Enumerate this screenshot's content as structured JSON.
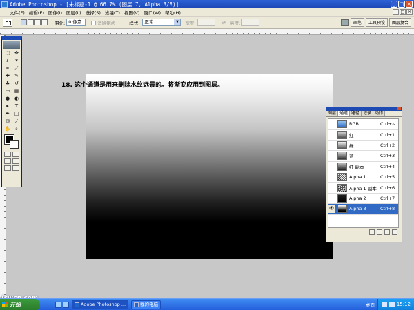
{
  "window": {
    "title": "Adobe Photoshop - [未标题-1 @ 66.7% (图层 7, Alpha 3/8)]"
  },
  "menu": [
    "文件(F)",
    "编辑(E)",
    "图像(I)",
    "图层(L)",
    "选择(S)",
    "滤镜(T)",
    "视图(V)",
    "窗口(W)",
    "帮助(H)"
  ],
  "options": {
    "feather_label": "羽化:",
    "feather_value": "0 像素",
    "antialias_label": "消除锯齿",
    "style_label": "样式:",
    "style_value": "正常",
    "width_label": "宽度:",
    "height_label": "高度:"
  },
  "palette_well": {
    "brushes": "画笔",
    "tool_presets": "工具预设",
    "layer_comps": "图层复合"
  },
  "caption": "18. 这个通道是用来删除水纹远景的。将渐变应用到图层。",
  "channels_palette": {
    "tabs": [
      "图层",
      "通道",
      "路径",
      "记录",
      "动作"
    ],
    "active_tab": "通道",
    "rows": [
      {
        "name": "RGB",
        "shortcut": "Ctrl+~",
        "visible": false,
        "selected": false
      },
      {
        "name": "红",
        "shortcut": "Ctrl+1",
        "visible": false,
        "selected": false
      },
      {
        "name": "绿",
        "shortcut": "Ctrl+2",
        "visible": false,
        "selected": false
      },
      {
        "name": "蓝",
        "shortcut": "Ctrl+3",
        "visible": false,
        "selected": false
      },
      {
        "name": "红 副本",
        "shortcut": "Ctrl+4",
        "visible": false,
        "selected": false
      },
      {
        "name": "Alpha 1",
        "shortcut": "Ctrl+5",
        "visible": false,
        "selected": false
      },
      {
        "name": "Alpha 1 副本",
        "shortcut": "Ctrl+6",
        "visible": false,
        "selected": false
      },
      {
        "name": "Alpha 2",
        "shortcut": "Ctrl+7",
        "visible": false,
        "selected": false
      },
      {
        "name": "Alpha 3",
        "shortcut": "Ctrl+8",
        "visible": true,
        "selected": true
      }
    ]
  },
  "watermark": "Jcwcn.com",
  "taskbar": {
    "start": "开始",
    "tasks": [
      "Adobe Photoshop ...",
      "我的电脑"
    ],
    "desktop": "桌面",
    "clock": "15:12"
  },
  "colors": {
    "foreground": "#000000",
    "background": "#ffffff",
    "selection": "#316ac5",
    "titlebar": "#1b46b4"
  }
}
